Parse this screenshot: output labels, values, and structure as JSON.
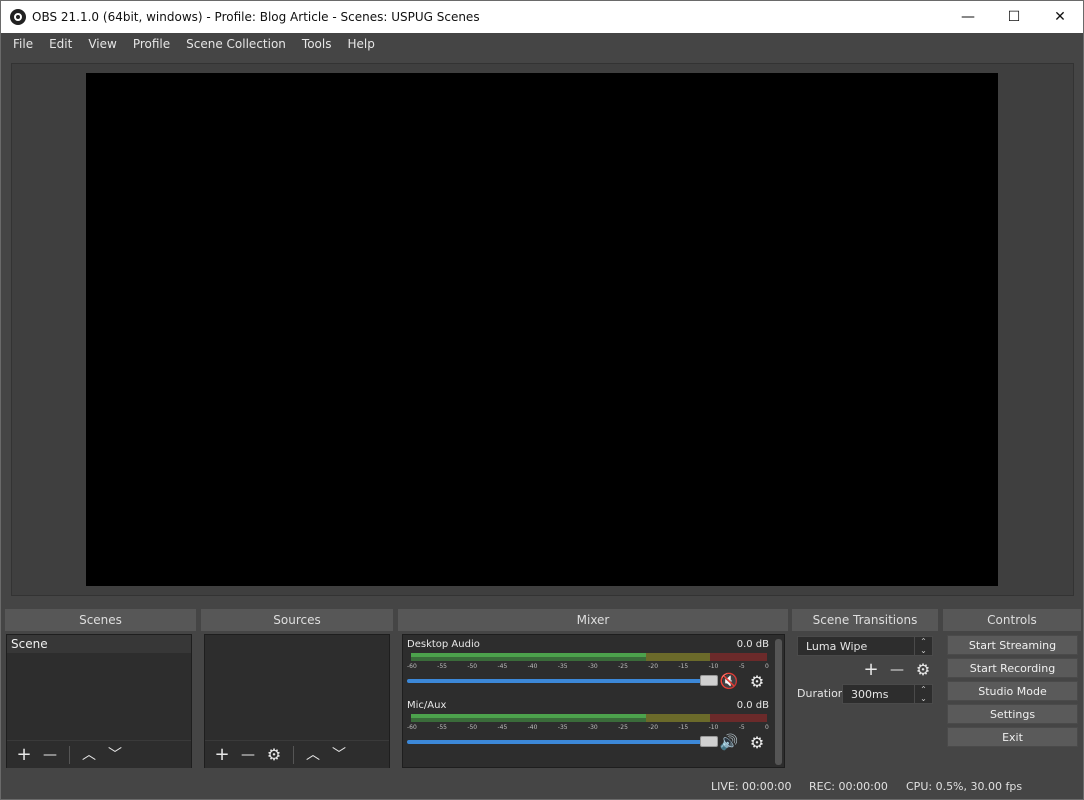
{
  "window": {
    "title": "OBS 21.1.0 (64bit, windows) - Profile: Blog Article - Scenes: USPUG Scenes",
    "minimize": "—",
    "maximize": "☐",
    "close": "✕"
  },
  "menu": [
    "File",
    "Edit",
    "View",
    "Profile",
    "Scene Collection",
    "Tools",
    "Help"
  ],
  "docks": {
    "scenes": {
      "title": "Scenes",
      "items": [
        "Scene"
      ]
    },
    "sources": {
      "title": "Sources"
    },
    "mixer": {
      "title": "Mixer"
    },
    "transitions": {
      "title": "Scene Transitions"
    },
    "controls": {
      "title": "Controls"
    }
  },
  "mixer": {
    "ticks": [
      "-60",
      "-55",
      "-50",
      "-45",
      "-40",
      "-35",
      "-30",
      "-25",
      "-20",
      "-15",
      "-10",
      "-5",
      "0"
    ],
    "channels": [
      {
        "name": "Desktop Audio",
        "db": "0.0 dB",
        "muted": true,
        "volume_pct": 100
      },
      {
        "name": "Mic/Aux",
        "db": "0.0 dB",
        "muted": false,
        "volume_pct": 100
      }
    ]
  },
  "transitions": {
    "selected": "Luma Wipe",
    "duration_label": "Duration",
    "duration_value": "300ms"
  },
  "controls": {
    "start_streaming": "Start Streaming",
    "start_recording": "Start Recording",
    "studio_mode": "Studio Mode",
    "settings": "Settings",
    "exit": "Exit"
  },
  "status": {
    "live": "LIVE: 00:00:00",
    "rec": "REC: 00:00:00",
    "cpu": "CPU: 0.5%, 30.00 fps"
  },
  "icons": {
    "plus": "+",
    "minus": "—",
    "up": "︿",
    "down": "﹀",
    "gear": "⚙",
    "speaker": "🔊",
    "speaker_muted": "🔇"
  },
  "colors": {
    "accent": "#3c88d8",
    "muted": "#e04040"
  }
}
